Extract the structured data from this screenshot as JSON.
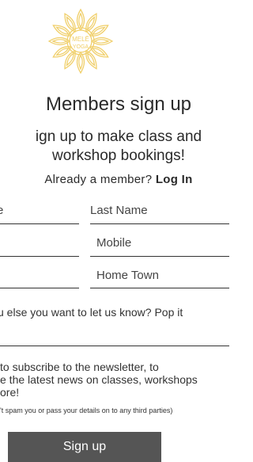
{
  "logo": {
    "line1": "MELĒ",
    "line2": "YOGA",
    "color": "#f0cf6a"
  },
  "heading": "Members sign up",
  "subheading_line1": "ign up to make class and",
  "subheading_line2": "workshop bookings!",
  "member_prompt": "Already a member?",
  "login_link": "Log In",
  "fields": {
    "first_name_partial": "e",
    "last_name": "Last Name",
    "mobile": "Mobile",
    "home_town": "Home Town"
  },
  "message_prompt": "u else you want to let us know?  Pop it",
  "newsletter_line1": "to subscribe to the newsletter, to",
  "newsletter_line2": "e the latest news on classes, workshops",
  "newsletter_line3": "ore!",
  "privacy_note": "'t spam you or pass your details on to any third parties)",
  "signup_button": "Sign up"
}
